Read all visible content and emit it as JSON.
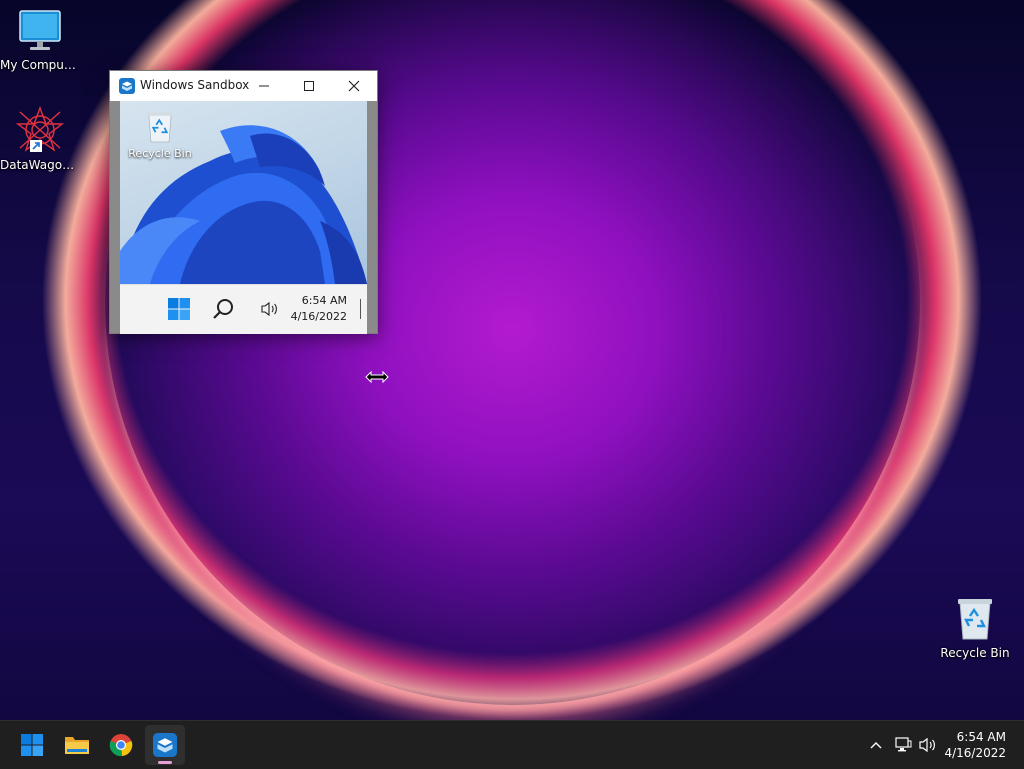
{
  "desktop": {
    "icons": [
      {
        "label": "My Computer"
      },
      {
        "label": "DataWagon..."
      },
      {
        "label": "Recycle Bin"
      }
    ]
  },
  "sandbox_window": {
    "title": "Windows Sandbox",
    "inner": {
      "recycle_bin_label": "Recycle Bin",
      "clock_time": "6:54 AM",
      "clock_date": "4/16/2022"
    }
  },
  "taskbar": {
    "clock_time": "6:54 AM",
    "clock_date": "4/16/2022",
    "icons": [
      "start-icon",
      "file-explorer-icon",
      "chrome-icon",
      "windows-sandbox-icon"
    ]
  },
  "colors": {
    "taskbar_bg": "#1f1f1f",
    "accent_blue": "#0078d4",
    "indicator_pink": "#e7a0d6"
  }
}
